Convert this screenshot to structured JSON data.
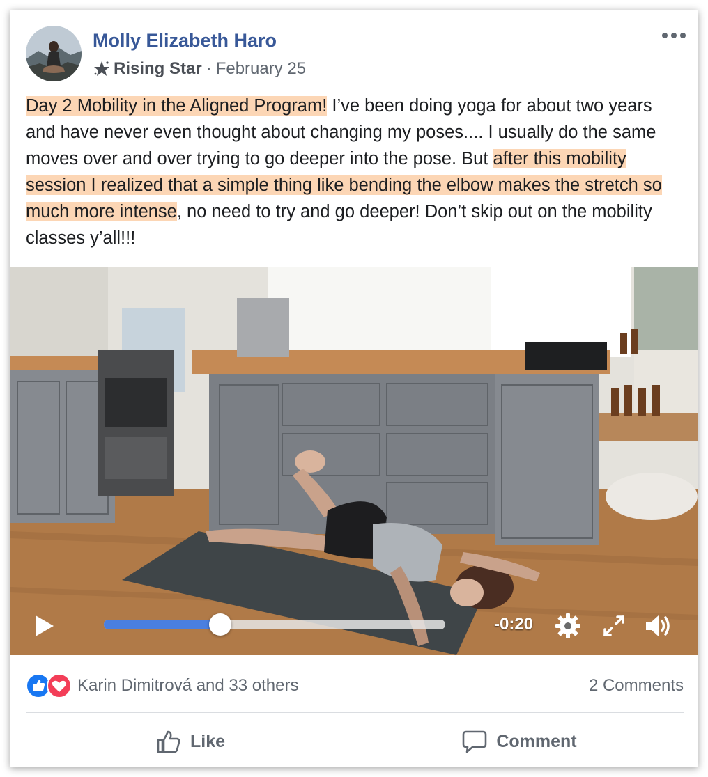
{
  "post": {
    "author": "Molly Elizabeth Haro",
    "badge": "Rising Star",
    "separator": "·",
    "date": "February 25",
    "more_icon": "ellipsis-icon",
    "text_parts": [
      {
        "text": "Day 2 Mobility in the Aligned Program!",
        "highlight": true
      },
      {
        "text": " I’ve been doing yoga for about two years and have never even thought about changing my poses.... I usually do the same moves over and over trying to go deeper into the pose. But ",
        "highlight": false
      },
      {
        "text": "after this mobility session I realized that a simple thing like bending the elbow makes the stretch so much more intense",
        "highlight": true
      },
      {
        "text": ", no need to try and go deeper! Don’t skip out on the mobility classes y’all!!!",
        "highlight": false
      }
    ],
    "highlight_color": "#fcd6b5"
  },
  "video": {
    "time_remaining": "-0:20",
    "progress": 0.34,
    "accent_color": "#4a7fe0",
    "icons": [
      "play-icon",
      "gear-icon",
      "fullscreen-icon",
      "volume-icon"
    ]
  },
  "reactions": {
    "icons": [
      "like-reaction-icon",
      "love-reaction-icon"
    ],
    "summary": "Karin Dimitrová and 33 others",
    "comments": "2 Comments"
  },
  "actions": {
    "like_label": "Like",
    "comment_label": "Comment"
  },
  "colors": {
    "author_link": "#385898",
    "secondary_text": "#606770"
  }
}
